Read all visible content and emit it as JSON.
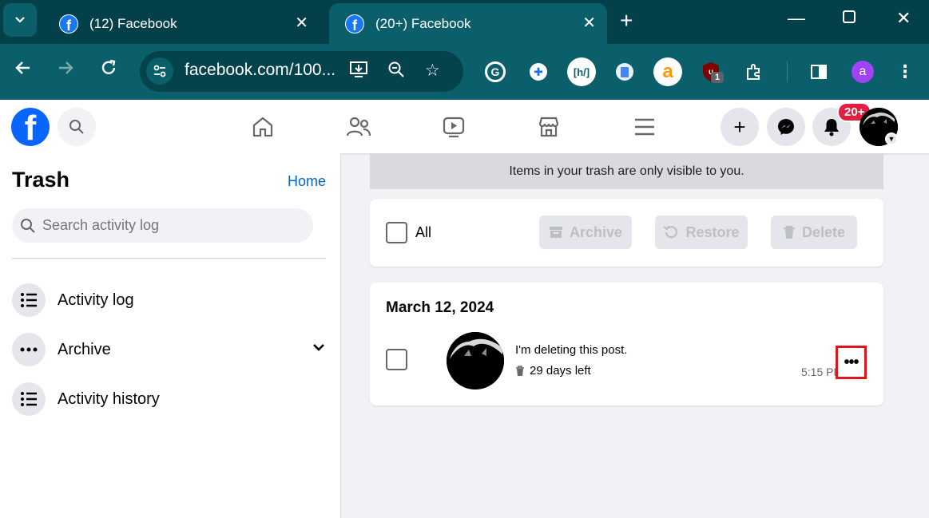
{
  "browser": {
    "tabs": [
      {
        "title": "(12) Facebook",
        "active": false
      },
      {
        "title": "(20+) Facebook",
        "active": true
      }
    ],
    "url": "facebook.com/100...",
    "extensions": [
      {
        "name": "grammarly-icon",
        "glyph": "G",
        "color": "#15c39a"
      },
      {
        "name": "extension-cross-icon",
        "glyph": "✚",
        "color": "#1a73e8"
      },
      {
        "name": "hs-extension-icon",
        "glyph": "[h/]",
        "color": "#ffffff"
      },
      {
        "name": "docs-extension-icon",
        "glyph": "▮",
        "color": "#4285f4"
      },
      {
        "name": "amazon-assistant-icon",
        "glyph": "a",
        "color": "#ff9900"
      },
      {
        "name": "ublock-icon",
        "glyph": "u",
        "color": "#800000"
      },
      {
        "name": "puzzle-icon",
        "glyph": "⧉",
        "color": "#ffffff"
      }
    ],
    "ublock_count": "1",
    "profile_initial": "a",
    "colors": {
      "tabstrip": "#044049",
      "toolbar": "#0b5f6a"
    }
  },
  "facebook": {
    "notification_badge": "20+",
    "sidebar": {
      "title": "Trash",
      "home_link": "Home",
      "search_placeholder": "Search activity log",
      "items": [
        {
          "label": "Activity log",
          "icon": "list-icon"
        },
        {
          "label": "Archive",
          "icon": "more-dots-icon",
          "expandable": true
        },
        {
          "label": "Activity history",
          "icon": "list-icon"
        }
      ]
    },
    "notice": "Items in your trash are only visible to you.",
    "bulk": {
      "all_label": "All",
      "archive": "Archive",
      "restore": "Restore",
      "delete": "Delete"
    },
    "group": {
      "date": "March 12, 2024",
      "post": {
        "text": "I'm deleting this post.",
        "days_left": "29 days left",
        "time": "5:15 PM"
      }
    },
    "colors": {
      "brand": "#0866ff",
      "link": "#0064d1",
      "badge": "#e41e3f",
      "highlight": "#e0141c"
    }
  }
}
